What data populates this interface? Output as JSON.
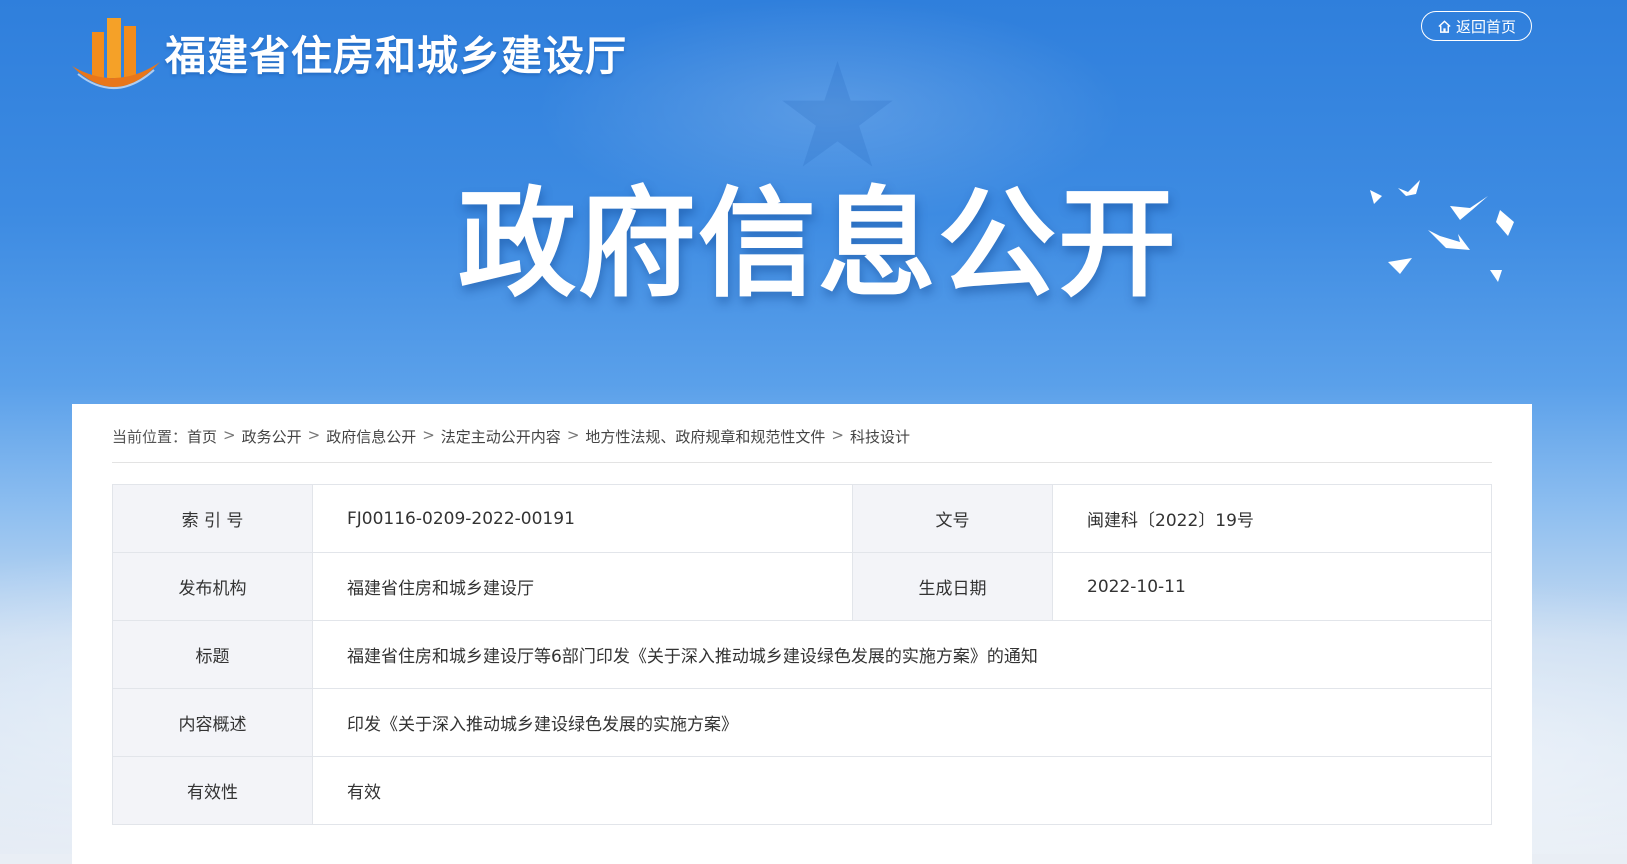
{
  "header": {
    "site_title": "福建省住房和城乡建设厅",
    "back_label": "返回首页",
    "hero_title": "政府信息公开"
  },
  "breadcrumb": {
    "prefix": "当前位置：",
    "items": [
      "首页",
      "政务公开",
      "政府信息公开",
      "法定主动公开内容",
      "地方性法规、政府规章和规范性文件",
      "科技设计"
    ],
    "separator": ">"
  },
  "meta": {
    "index_label": "索 引 号",
    "index_value": "FJ00116-0209-2022-00191",
    "docno_label": "文号",
    "docno_value": "闽建科〔2022〕19号",
    "publisher_label": "发布机构",
    "publisher_value": "福建省住房和城乡建设厅",
    "date_label": "生成日期",
    "date_value": "2022-10-11",
    "title_label": "标题",
    "title_value": "福建省住房和城乡建设厅等6部门印发《关于深入推动城乡建设绿色发展的实施方案》的通知",
    "summary_label": "内容概述",
    "summary_value": "印发《关于深入推动城乡建设绿色发展的实施方案》",
    "validity_label": "有效性",
    "validity_value": "有效"
  },
  "colors": {
    "banner_blue": "#2f7fdc",
    "logo_orange": "#f08a1e"
  }
}
